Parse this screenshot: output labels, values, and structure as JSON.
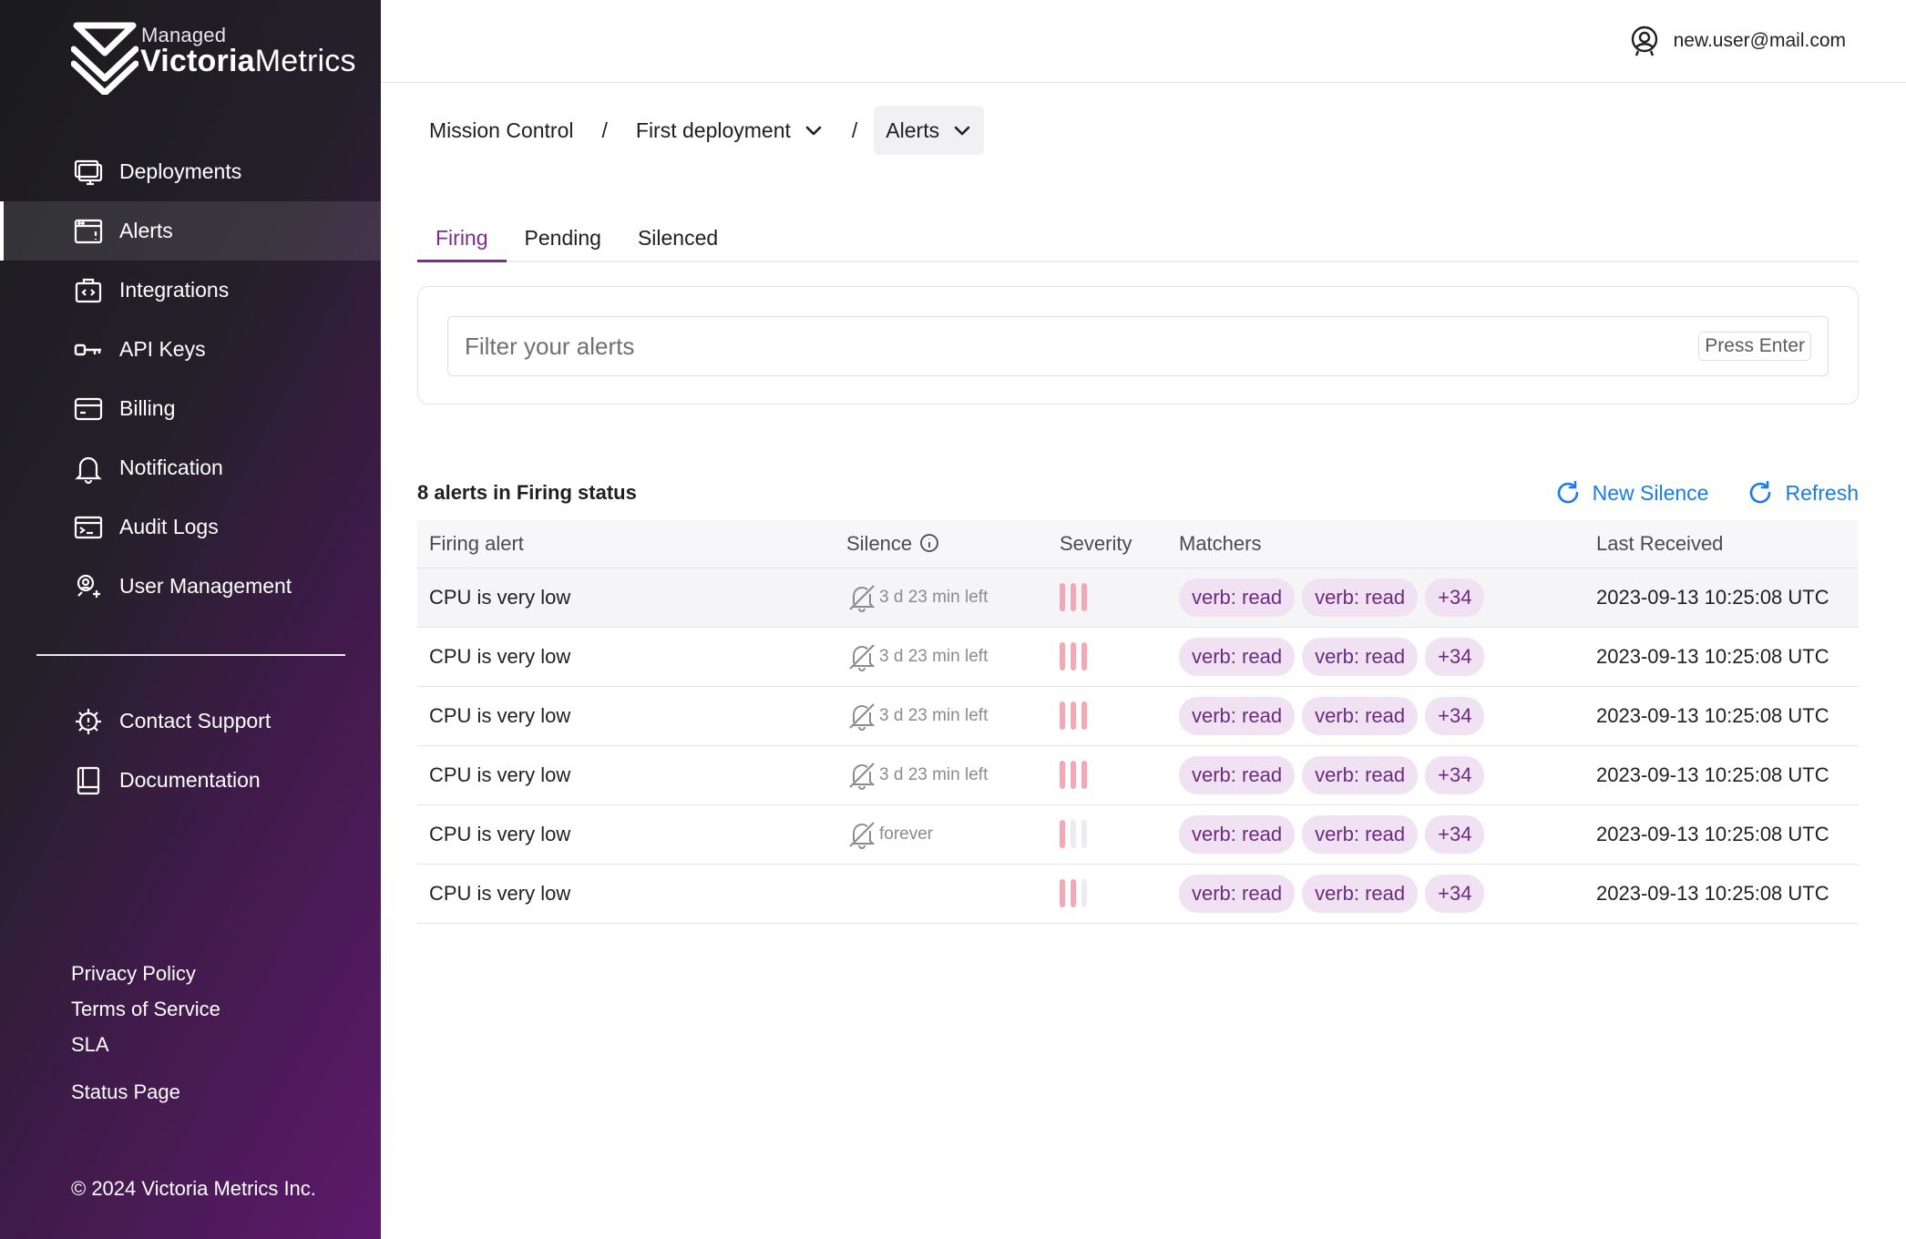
{
  "brand": {
    "sub": "Managed",
    "name_bold": "Victoria",
    "name_rest": "Metrics"
  },
  "user": {
    "email": "new.user@mail.com"
  },
  "sidebar": {
    "items": [
      {
        "label": "Deployments",
        "icon": "monitor-icon",
        "active": false
      },
      {
        "label": "Alerts",
        "icon": "alert-window-icon",
        "active": true
      },
      {
        "label": "Integrations",
        "icon": "integrations-icon",
        "active": false
      },
      {
        "label": "API Keys",
        "icon": "key-icon",
        "active": false
      },
      {
        "label": "Billing",
        "icon": "card-icon",
        "active": false
      },
      {
        "label": "Notification",
        "icon": "bell-icon",
        "active": false
      },
      {
        "label": "Audit Logs",
        "icon": "terminal-icon",
        "active": false
      },
      {
        "label": "User Management",
        "icon": "user-add-icon",
        "active": false
      }
    ],
    "support": [
      {
        "label": "Contact Support",
        "icon": "support-gear-icon"
      },
      {
        "label": "Documentation",
        "icon": "book-icon"
      }
    ],
    "legal": [
      "Privacy Policy",
      "Terms of Service",
      "SLA"
    ],
    "status_page": "Status Page",
    "copyright": "© 2024 Victoria Metrics Inc."
  },
  "breadcrumb": {
    "root": "Mission Control",
    "deployment": "First deployment",
    "section": "Alerts",
    "separator": "/"
  },
  "tabs": [
    {
      "label": "Firing",
      "active": true
    },
    {
      "label": "Pending",
      "active": false
    },
    {
      "label": "Silenced",
      "active": false
    }
  ],
  "filter": {
    "placeholder": "Filter your alerts",
    "hint": "Press Enter"
  },
  "table": {
    "count_label": "8 alerts in Firing status",
    "new_silence": "New Silence",
    "refresh": "Refresh",
    "columns": [
      "Firing alert",
      "Silence",
      "Severity",
      "Matchers",
      "Last Received"
    ],
    "rows": [
      {
        "alert": "CPU is very low",
        "silence": "3 d 23 min left",
        "severity": 3,
        "matchers": [
          "verb: read",
          "verb: read"
        ],
        "more": "+34",
        "last": "2023-09-13 10:25:08 UTC"
      },
      {
        "alert": "CPU is very low",
        "silence": "3 d 23 min left",
        "severity": 3,
        "matchers": [
          "verb: read",
          "verb: read"
        ],
        "more": "+34",
        "last": "2023-09-13 10:25:08 UTC"
      },
      {
        "alert": "CPU is very low",
        "silence": "3 d 23 min left",
        "severity": 3,
        "matchers": [
          "verb: read",
          "verb: read"
        ],
        "more": "+34",
        "last": "2023-09-13 10:25:08 UTC"
      },
      {
        "alert": "CPU is very low",
        "silence": "3 d 23 min left",
        "severity": 3,
        "matchers": [
          "verb: read",
          "verb: read"
        ],
        "more": "+34",
        "last": "2023-09-13 10:25:08 UTC"
      },
      {
        "alert": "CPU is very low",
        "silence": "forever",
        "severity": 1,
        "matchers": [
          "verb: read",
          "verb: read"
        ],
        "more": "+34",
        "last": "2023-09-13 10:25:08 UTC"
      },
      {
        "alert": "CPU is very low",
        "silence": "",
        "severity": 2,
        "matchers": [
          "verb: read",
          "verb: read"
        ],
        "more": "+34",
        "last": "2023-09-13 10:25:08 UTC"
      }
    ]
  },
  "colors": {
    "accent": "#7b2d8e",
    "link": "#1b7ce8",
    "severity_on": "#f4a7b5",
    "severity_off": "#ececf0",
    "chip_bg": "#f0e2f3"
  }
}
